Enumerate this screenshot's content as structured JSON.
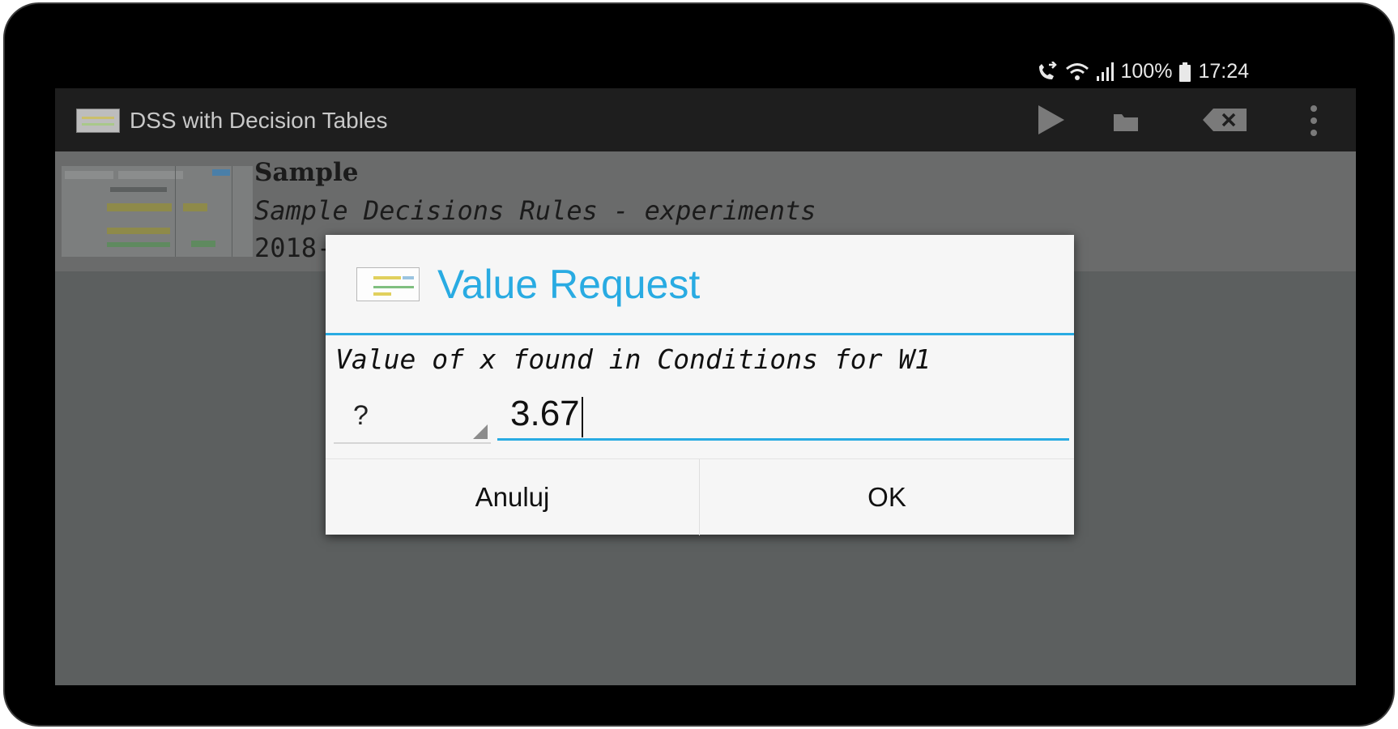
{
  "status_bar": {
    "battery": "100%",
    "time": "17:24",
    "icons": [
      "call-forward-icon",
      "wifi-icon",
      "signal-icon",
      "battery-icon"
    ]
  },
  "action_bar": {
    "title": "DSS with Decision Tables",
    "actions": [
      "play-icon",
      "folder-icon",
      "backspace-clear-icon",
      "overflow-menu-icon"
    ]
  },
  "list": {
    "items": [
      {
        "title": "Sample",
        "description": "Sample Decisions Rules - experiments",
        "date": "2018-"
      }
    ]
  },
  "dialog": {
    "title": "Value Request",
    "message": "Value of x found in Conditions for W1",
    "spinner_value": "?",
    "input_value": "3.67",
    "cancel_label": "Anuluj",
    "ok_label": "OK"
  },
  "colors": {
    "accent": "#29abe2",
    "dialog_background": "#f6f6f6",
    "dimmed_content": "#5c5f5f"
  }
}
